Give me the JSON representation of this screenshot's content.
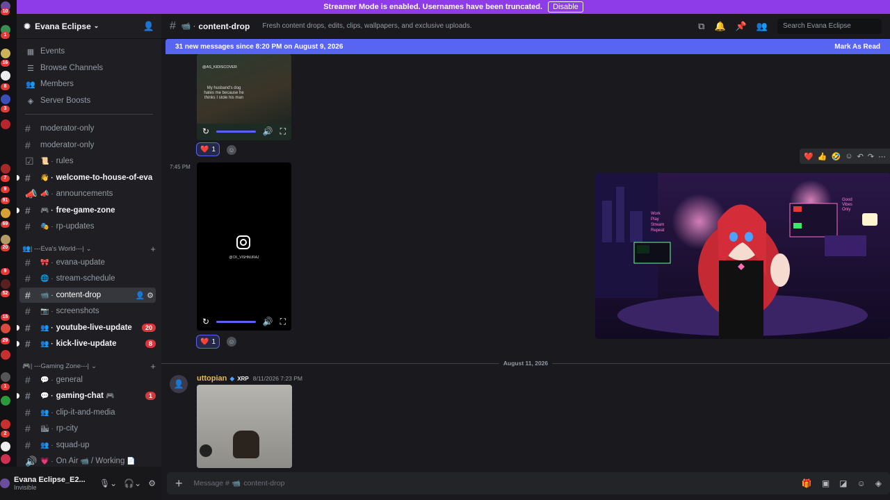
{
  "streamer_banner": {
    "text": "Streamer Mode is enabled. Usernames have been truncated.",
    "button": "Disable"
  },
  "server_rail": {
    "badges": [
      "10",
      "1",
      "16",
      "8",
      "3",
      "7",
      "9",
      "91",
      "3",
      "69",
      "20",
      "9",
      "52",
      "15",
      "29",
      "1",
      "2"
    ]
  },
  "server": {
    "name": "Evana Eclipse"
  },
  "nav": {
    "events": "Events",
    "browse": "Browse Channels",
    "members": "Members",
    "boosts": "Server Boosts"
  },
  "channels": {
    "mod1": "moderator-only",
    "mod2": "moderator-only",
    "rules": "rules",
    "welcome": "welcome-to-house-of-eva",
    "announcements": "announcements",
    "freegame": "free-game-zone",
    "rpupdates": "rp-updates",
    "cat_world": "| ---Eva's World---|",
    "evana_update": "evana-update",
    "stream_schedule": "stream-schedule",
    "content_drop": "content-drop",
    "screenshots": "screenshots",
    "youtube": "youtube-live-update",
    "youtube_badge": "20",
    "kick": "kick-live-update",
    "kick_badge": "8",
    "cat_gaming": "| ---Gaming Zone---|",
    "general": "general",
    "gaming_chat": "gaming-chat",
    "gaming_badge": "1",
    "clip": "clip-it-and-media",
    "rpcity": "rp-city",
    "squad": "squad-up",
    "onair": "On Air",
    "working": "/ Working"
  },
  "user": {
    "name": "Evana Eclipse_E2...",
    "status": "Invisible"
  },
  "header": {
    "channel": "content-drop",
    "topic": "Fresh content drops, edits, clips, wallpapers, and exclusive uploads.",
    "search_placeholder": "Search Evana Eclipse"
  },
  "new_messages": {
    "text": "31 new messages since 8:20 PM on August 9, 2026",
    "mark": "Mark As Read"
  },
  "messages": {
    "video1_caption_user": "@AS_KIDISCOVER",
    "video1_caption": "My husband's dog hates me because he thinks I stole his man",
    "react1_count": "1",
    "time2": "7:45 PM",
    "video2_user": "@CK_VISHNURAJ",
    "react2_count": "1",
    "date_divider": "August 11, 2026",
    "author": "uttopian",
    "author_tag": "XRP",
    "author_time": "8/11/2026 7:23 PM"
  },
  "composer": {
    "placeholder": "Message #",
    "channel": "content-drop"
  },
  "colors": {
    "accent": "#5865f2",
    "streamer": "#8d3ce8",
    "badge": "#da373c"
  }
}
